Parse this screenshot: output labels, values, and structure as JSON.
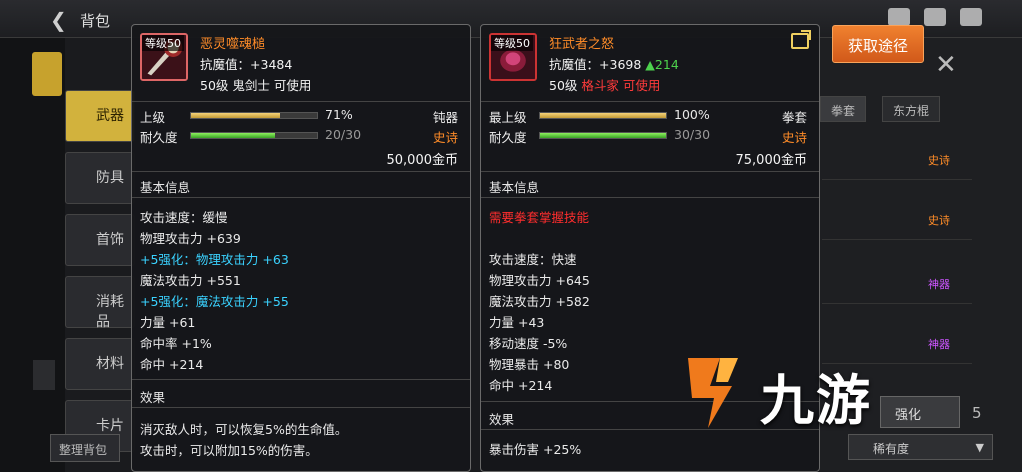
{
  "topbar": {
    "back_glyph": "❮",
    "title": "背包"
  },
  "tabs": [
    "武器",
    "防具",
    "首饰",
    "消耗品",
    "材料",
    "卡片"
  ],
  "bottom_button": "整理背包",
  "right": {
    "get_button": "获取途径",
    "tabs": [
      "拳套",
      "东方棍"
    ],
    "rows": [
      {
        "tag": "史诗",
        "color": "#ff8c28"
      },
      {
        "tag": "史诗",
        "color": "#ff8c28"
      },
      {
        "tag": "神器",
        "color": "#cc55ff"
      },
      {
        "tag": "神器",
        "color": "#cc55ff"
      }
    ],
    "enhance_button": "强化",
    "sort_label": "稀有度",
    "page_num": "5"
  },
  "left_item": {
    "icon": "mace-icon",
    "level_badge": "等级50",
    "name": "恶灵噬魂槌",
    "resist_label": "抗魔值：",
    "resist_value": "+3484",
    "requirement": "50级 鬼剑士 可使用",
    "grade_label": "上级",
    "grade_pct": "71%",
    "grade_fill": 0.71,
    "weapon_type": "钝器",
    "durability_label": "耐久度",
    "durability": "20/30",
    "durability_fill": 0.67,
    "rarity": "史诗",
    "price": "50,000金币",
    "basic_title": "基本信息",
    "stats": [
      {
        "text": "攻击速度：缓慢",
        "kind": "normal"
      },
      {
        "text": "物理攻击力 +639",
        "kind": "normal"
      },
      {
        "text": "+5强化：物理攻击力 +63",
        "kind": "cyan"
      },
      {
        "text": "魔法攻击力 +551",
        "kind": "normal"
      },
      {
        "text": "+5强化：魔法攻击力 +55",
        "kind": "cyan"
      },
      {
        "text": "力量 +61",
        "kind": "normal"
      },
      {
        "text": "命中率 +1%",
        "kind": "normal"
      },
      {
        "text": "命中 +214",
        "kind": "normal"
      }
    ],
    "effect_title": "效果",
    "effects": [
      "消灭敌人时，可以恢复5%的生命值。",
      "攻击时，可以附加15%的伤害。"
    ]
  },
  "right_item": {
    "icon": "gauntlet-icon",
    "level_badge": "等级50",
    "name": "狂武者之怒",
    "resist_label": "抗魔值：",
    "resist_value": "+3698",
    "resist_up": "▲214",
    "req_level": "50级",
    "req_class": "格斗家 可使用",
    "grade_label": "最上级",
    "grade_pct": "100%",
    "grade_fill": 1.0,
    "weapon_type": "拳套",
    "durability_label": "耐久度",
    "durability": "30/30",
    "durability_fill": 1.0,
    "rarity": "史诗",
    "price": "75,000金币",
    "basic_title": "基本信息",
    "warning": "需要拳套掌握技能",
    "stats": [
      "攻击速度：快速",
      "物理攻击力 +645",
      "魔法攻击力 +582",
      "力量 +43",
      "移动速度 -5%",
      "物理暴击 +80",
      "命中 +214"
    ],
    "effect_title": "效果",
    "effects": [
      "暴击伤害 +25%"
    ]
  },
  "watermark": {
    "text": "九游",
    "logo": "jiuyou-logo"
  }
}
